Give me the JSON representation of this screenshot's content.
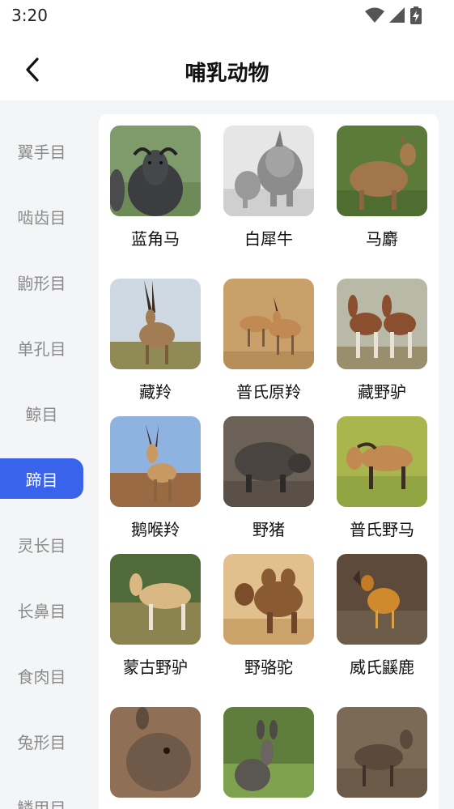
{
  "status_bar": {
    "time": "3:20",
    "icons": [
      "wifi-icon",
      "signal-icon",
      "battery-charging-icon"
    ]
  },
  "header": {
    "title": "哺乳动物",
    "back_icon": "chevron-left-icon"
  },
  "sidebar": {
    "items": [
      {
        "label": "翼手目",
        "active": false
      },
      {
        "label": "啮齿目",
        "active": false
      },
      {
        "label": "鼩形目",
        "active": false
      },
      {
        "label": "单孔目",
        "active": false
      },
      {
        "label": "鲸目",
        "active": false
      },
      {
        "label": "蹄目",
        "active": true
      },
      {
        "label": "灵长目",
        "active": false
      },
      {
        "label": "长鼻目",
        "active": false
      },
      {
        "label": "食肉目",
        "active": false
      },
      {
        "label": "兔形目",
        "active": false
      },
      {
        "label": "鳞甲目",
        "active": false
      }
    ],
    "active_color": "#3a63ec"
  },
  "grid": {
    "animals": [
      {
        "name": "蓝角马",
        "photo": "blue-wildebeest"
      },
      {
        "name": "白犀牛",
        "photo": "white-rhino"
      },
      {
        "name": "马麝",
        "photo": "alpine-musk-deer"
      },
      {
        "name": "藏羚",
        "photo": "tibetan-antelope"
      },
      {
        "name": "普氏原羚",
        "photo": "przewalski-gazelle"
      },
      {
        "name": "藏野驴",
        "photo": "kiang"
      },
      {
        "name": "鹅喉羚",
        "photo": "goitered-gazelle"
      },
      {
        "name": "野猪",
        "photo": "wild-boar"
      },
      {
        "name": "普氏野马",
        "photo": "przewalski-horse"
      },
      {
        "name": "蒙古野驴",
        "photo": "mongolian-wild-ass"
      },
      {
        "name": "野骆驼",
        "photo": "wild-camel"
      },
      {
        "name": "威氏鼷鹿",
        "photo": "williamson-mouse-deer"
      },
      {
        "name": "",
        "photo": "musk-deer"
      },
      {
        "name": "",
        "photo": "forest-musk-deer"
      },
      {
        "name": "",
        "photo": "muntjac"
      }
    ]
  }
}
